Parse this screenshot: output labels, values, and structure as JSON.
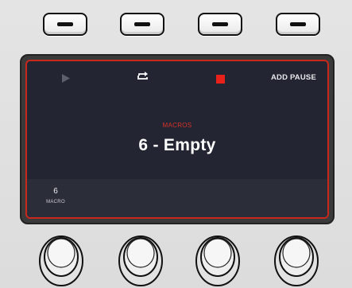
{
  "softkeys": [
    {
      "name": "softkey-1"
    },
    {
      "name": "softkey-2"
    },
    {
      "name": "softkey-3"
    },
    {
      "name": "softkey-4"
    }
  ],
  "lcd": {
    "toolbar": {
      "play_icon": "play-icon",
      "loop_icon": "loop-icon",
      "stop_icon": "stop-icon",
      "add_pause_label": "ADD PAUSE"
    },
    "section_label": "MACROS",
    "title": "6 - Empty",
    "param": {
      "value": "6",
      "label": "MACRO"
    }
  },
  "colors": {
    "accent_red": "#c8281c",
    "screen_bg": "#232532",
    "panel_bg": "#e0e0e0"
  }
}
